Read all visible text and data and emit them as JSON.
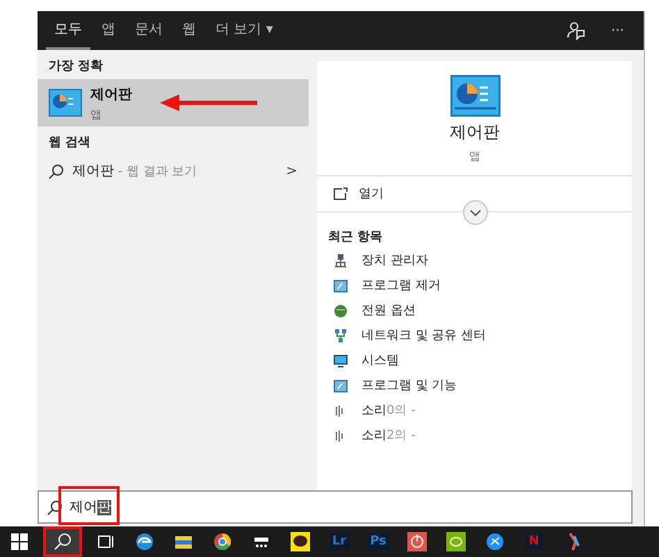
{
  "header": {
    "tabs": [
      {
        "label": "모두",
        "selected": true
      },
      {
        "label": "앱",
        "selected": false
      },
      {
        "label": "문서",
        "selected": false
      },
      {
        "label": "웹",
        "selected": false
      },
      {
        "label": "더 보기 ▾",
        "selected": false
      }
    ],
    "more": "···"
  },
  "best_match": {
    "heading": "가장 정확",
    "item": {
      "name": "제어판",
      "type": "앱",
      "selected": true
    }
  },
  "web_search": {
    "heading": "웹 검색",
    "item": {
      "query": "제어판",
      "suffix": " - 웹 결과 보기",
      "chevron": ">"
    }
  },
  "detail": {
    "name": "제어판",
    "type": "앱",
    "actions": [
      {
        "label": "열기"
      }
    ],
    "recent_heading": "최근 항목",
    "recent": [
      {
        "name": "장치 관리자",
        "kind": "device"
      },
      {
        "name": "프로그램 제거",
        "kind": "program"
      },
      {
        "name": "전원 옵션",
        "kind": "power"
      },
      {
        "name": "네트워크 및 공유 센터",
        "kind": "network"
      },
      {
        "name": "시스템",
        "kind": "system"
      },
      {
        "name": "프로그램 및 기능",
        "kind": "program"
      },
      {
        "name": "소리",
        "detail": "0의 -",
        "kind": "sound"
      },
      {
        "name": "소리",
        "detail": "2의 -",
        "kind": "sound"
      }
    ]
  },
  "search": {
    "value": "제어",
    "composing": "판"
  },
  "taskbar": [
    {
      "kind": "windows"
    },
    {
      "kind": "search",
      "selected": true
    },
    {
      "kind": "taskview"
    },
    {
      "kind": "edge"
    },
    {
      "kind": "folder"
    },
    {
      "kind": "chrome"
    },
    {
      "kind": "tray"
    },
    {
      "kind": "chat"
    },
    {
      "kind": "text",
      "label": "Lr",
      "color": "#2a6fb8"
    },
    {
      "kind": "text",
      "label": "Ps",
      "color": "#2a7fd4"
    },
    {
      "kind": "power"
    },
    {
      "kind": "green"
    },
    {
      "kind": "blue"
    },
    {
      "kind": "text",
      "label": "N",
      "color": "#e50914"
    },
    {
      "kind": "tool"
    }
  ]
}
